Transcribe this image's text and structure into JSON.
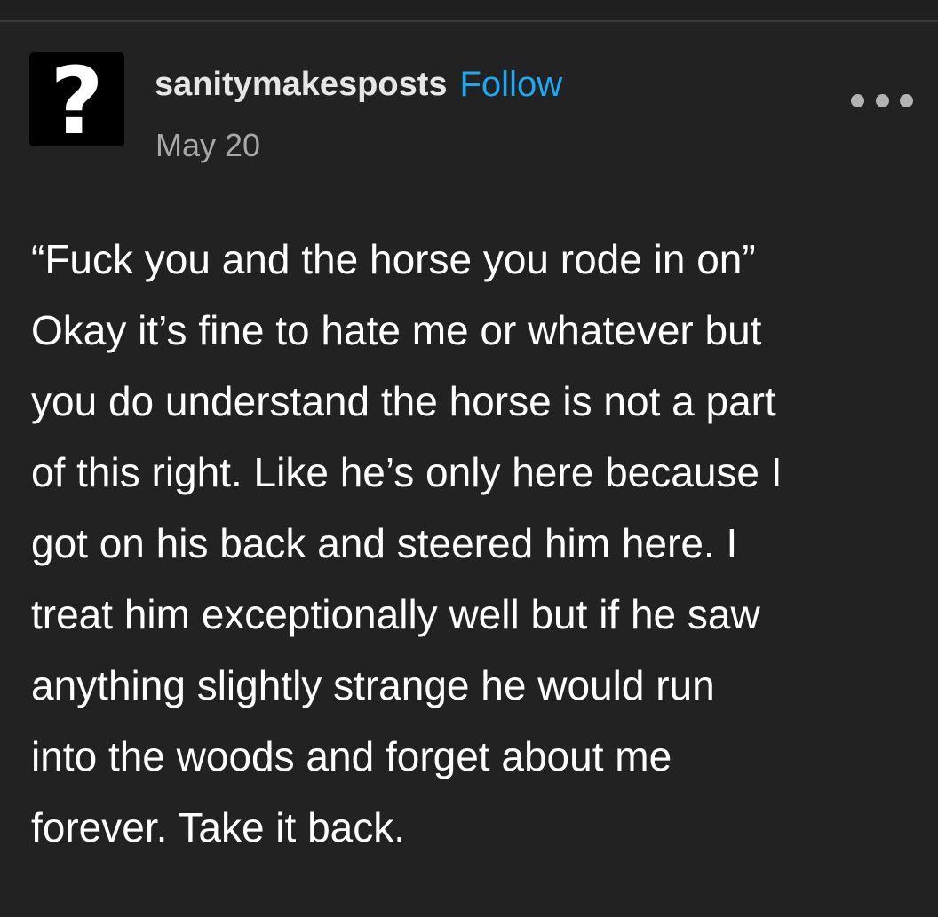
{
  "post": {
    "avatar_icon": "question-mark-avatar-icon",
    "avatar_glyph": "?",
    "username": "sanitymakesposts",
    "follow_label": "Follow",
    "date": "May 20",
    "more_icon": "more-options-icon",
    "body_lines": [
      "“Fuck you and the horse you rode in on”",
      "Okay it’s fine to hate me or whatever but",
      "you do understand the horse is not a part",
      "of this right. Like he’s only here because I",
      "got on his back and steered him here. I",
      "treat him exceptionally well but if he saw",
      "anything slightly strange he would run",
      "into the woods and forget about me",
      "forever. Take it back."
    ]
  },
  "colors": {
    "background": "#222222",
    "text": "#ffffff",
    "accent": "#1da8f1",
    "muted": "#a8a8a8"
  }
}
